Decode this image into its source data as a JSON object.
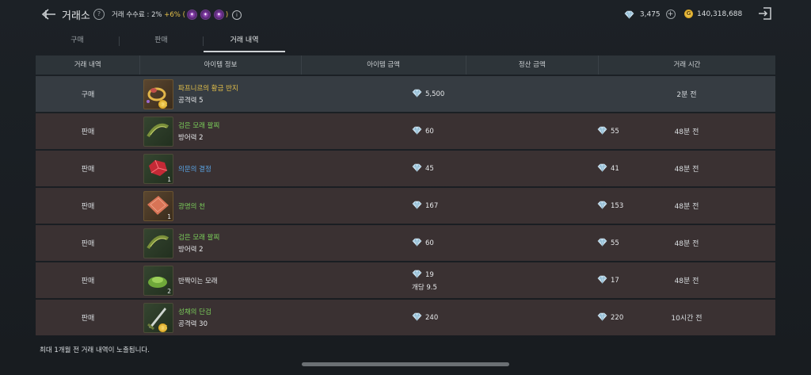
{
  "header": {
    "title": "거래소",
    "help_glyph": "?",
    "fee_label": "거래 수수료 : 2%",
    "fee_bonus": "+6%",
    "paren_open": "(",
    "paren_close": ")",
    "info_glyph": "i",
    "diamonds": "3,475",
    "gold": "140,318,688",
    "gold_glyph": "G",
    "plus_glyph": "+"
  },
  "tabs": [
    {
      "label": "구매",
      "active": false
    },
    {
      "label": "판매",
      "active": false
    },
    {
      "label": "거래 내역",
      "active": true
    }
  ],
  "table": {
    "headers": [
      "거래 내역",
      "아이템 정보",
      "아이템 금액",
      "정산 금액",
      "거래 시간"
    ],
    "rows": [
      {
        "type": "구매",
        "name": "파프니르의 황금 반지",
        "name_color": "yellow",
        "stat": "공격력 5",
        "qty": "+2",
        "qty_gold": true,
        "price": "5,500",
        "price_sub": "",
        "settle": "",
        "time": "2분 전",
        "icon": "ring-icon"
      },
      {
        "type": "판매",
        "name": "검은 모래 팔찌",
        "name_color": "green",
        "stat": "방어력 2",
        "qty": "",
        "qty_gold": false,
        "price": "60",
        "price_sub": "",
        "settle": "55",
        "time": "48분 전",
        "icon": "bracelet-icon"
      },
      {
        "type": "판매",
        "name": "의문의 결정",
        "name_color": "blue",
        "stat": "",
        "qty": "1",
        "qty_gold": false,
        "price": "45",
        "price_sub": "",
        "settle": "41",
        "time": "48분 전",
        "icon": "crystal-icon"
      },
      {
        "type": "판매",
        "name": "광명의 천",
        "name_color": "green",
        "stat": "",
        "qty": "1",
        "qty_gold": false,
        "price": "167",
        "price_sub": "",
        "settle": "153",
        "time": "48분 전",
        "icon": "cloth-icon"
      },
      {
        "type": "판매",
        "name": "검은 모래 팔찌",
        "name_color": "green",
        "stat": "방어력 2",
        "qty": "",
        "qty_gold": false,
        "price": "60",
        "price_sub": "",
        "settle": "55",
        "time": "48분 전",
        "icon": "bracelet-icon"
      },
      {
        "type": "판매",
        "name": "반짝이는 모래",
        "name_color": "white",
        "stat": "",
        "qty": "2",
        "qty_gold": false,
        "price": "19",
        "price_sub": "개당 9.5",
        "settle": "17",
        "time": "48분 전",
        "icon": "sand-icon"
      },
      {
        "type": "판매",
        "name": "성채의 단검",
        "name_color": "green",
        "stat": "공격력 30",
        "qty": "+6",
        "qty_gold": true,
        "price": "240",
        "price_sub": "",
        "settle": "220",
        "time": "10시간 전",
        "icon": "dagger-icon"
      }
    ]
  },
  "footer_note": "최대 1개월 전 거래 내역이 노출됩니다.",
  "colors": {
    "yellow": "#e6c24a",
    "green": "#7bcf5a",
    "blue": "#5aa6e8",
    "white": "#e6e8ea"
  }
}
